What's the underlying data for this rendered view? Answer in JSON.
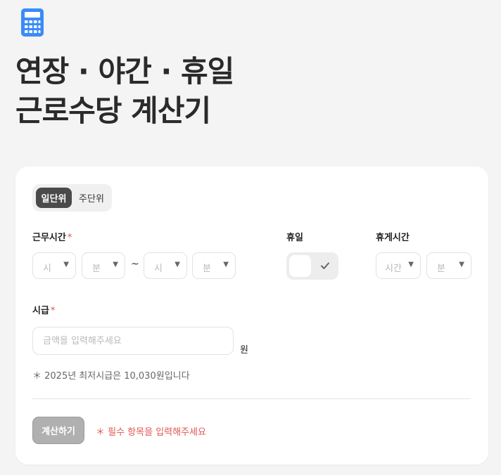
{
  "header": {
    "app_icon": "calculator-icon",
    "title_line1": "연장 · 야간 · 휴일",
    "title_line2": "근로수당 계산기"
  },
  "mode_toggle": {
    "options": [
      {
        "label": "일단위",
        "active": true
      },
      {
        "label": "주단위",
        "active": false
      }
    ]
  },
  "work_time": {
    "label": "근무시간",
    "required_mark": "*",
    "start_hour_placeholder": "시",
    "start_minute_placeholder": "분",
    "separator": "~",
    "end_hour_placeholder": "시",
    "end_minute_placeholder": "분"
  },
  "holiday": {
    "label": "휴일",
    "checked": false
  },
  "break_time": {
    "label": "휴게시간",
    "hour_placeholder": "시간",
    "minute_placeholder": "분"
  },
  "hourly_wage": {
    "label": "시급",
    "required_mark": "*",
    "placeholder": "금액을 입력해주세요",
    "unit": "원",
    "hint": "＊ 2025년 최저시급은 10,030원입니다"
  },
  "footer": {
    "calculate_label": "계산하기",
    "error_message": "＊ 필수 항목을 입력해주세요"
  },
  "colors": {
    "accent_dark": "#4a4a4a",
    "required_red": "#e2554f",
    "icon_blue": "#3b8cf5",
    "button_disabled": "#b0b0b0"
  }
}
